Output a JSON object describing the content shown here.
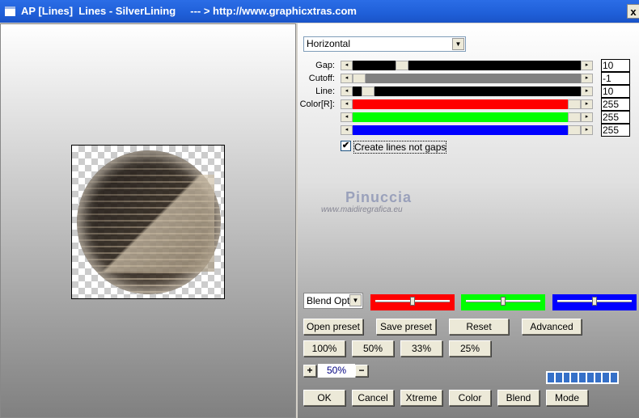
{
  "window": {
    "title": "AP [Lines]  Lines - SilverLining     --- > http://www.graphicxtras.com",
    "close_label": "x"
  },
  "watermark": {
    "name": "Pinuccia",
    "url": "www.maidiregrafica.eu"
  },
  "direction_select": {
    "value": "Horizontal"
  },
  "sliders": [
    {
      "label": "Gap:",
      "value": "10",
      "fraction": 0.2,
      "color": "#000000"
    },
    {
      "label": "Cutoff:",
      "value": "-1",
      "fraction": 0.0,
      "color": "#808080"
    },
    {
      "label": "Line:",
      "value": "10",
      "fraction": 0.04,
      "color": "#000000"
    },
    {
      "label": "Color[R]:",
      "value": "255",
      "fraction": 1.0,
      "color": "#ff0000"
    },
    {
      "label": "",
      "value": "255",
      "fraction": 1.0,
      "color": "#00ff00"
    },
    {
      "label": "",
      "value": "255",
      "fraction": 1.0,
      "color": "#0000ff"
    }
  ],
  "checkbox": {
    "label": "Create lines not gaps",
    "checked": true
  },
  "blend_select": {
    "value": "Blend Opti"
  },
  "blend_swatches": [
    {
      "color": "#ff0000",
      "fraction": 0.5
    },
    {
      "color": "#00ff00",
      "fraction": 0.5
    },
    {
      "color": "#0000ff",
      "fraction": 0.5
    }
  ],
  "preset_buttons": [
    "Open preset",
    "Save preset",
    "Reset",
    "Advanced"
  ],
  "zoom_buttons": [
    "100%",
    "50%",
    "33%",
    "25%"
  ],
  "zoom": {
    "plus": "+",
    "value": "50%",
    "minus": "−"
  },
  "bottom_buttons": [
    "OK",
    "Cancel",
    "Xtreme",
    "Color",
    "Blend",
    "Mode"
  ],
  "progress_segments": 9
}
